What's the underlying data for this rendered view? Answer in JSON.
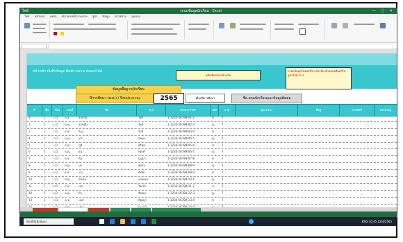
{
  "window": {
    "title": "ระบบข้อมูลนักเรียน - Excel",
    "left_text": "ไฟล์",
    "controls": "— ▢ ✕"
  },
  "menubar": [
    "ไฟล์",
    "หน้าแรก",
    "แทรก",
    "เค้าโครงหน้ากระดาษ",
    "สูตร",
    "ข้อมูล",
    "ตรวจทาน",
    "มุมมอง"
  ],
  "sheet": {
    "menu_line": "หน้าหลัก  บันทึกข้อมูล  พิมพ์รายงาน  ส่งออกไฟล์",
    "title_box": "ข้อมูลพื้นฐานนักเรียน",
    "year_label": "ปีการศึกษา (พ.ศ.) / ปีงบประมาณ",
    "year_value": "2565",
    "button_label": "เลือกปีการศึกษา",
    "grey_header": "ชื่อ-สกุลนักเรียนและข้อมูลติดต่อ",
    "note1": "คลิกเพื่อกลับหน้าหลัก",
    "note2": "กรอกข้อมูลในช่องสีขาวเท่านั้น ห้ามลบหรือแก้ไขสูตรในตาราง"
  },
  "table_headers": [
    "ที่",
    "ชั้น",
    "ห้อง",
    "เลขที่",
    "ชื่อ",
    "สกุล",
    "เลขประจำตัว",
    "เพศ",
    "อายุ",
    "ผู้ปกครอง",
    "ที่อยู่",
    "โทรศัพท์",
    "หมายเหตุ"
  ],
  "rows": [
    [
      "1",
      "1",
      "ป.1",
      "ด.ช.",
      "สมชาย",
      "ใจดี",
      "1-1234-56789-01-2",
      "ช",
      "7"
    ],
    [
      "2",
      "1",
      "ป.1",
      "ด.ญ.",
      "สมหญิง",
      "ใจดี",
      "1-1234-56789-02-3",
      "ญ",
      "7"
    ],
    [
      "3",
      "1",
      "ป.1",
      "ด.ช.",
      "ก้อง",
      "รักดี",
      "1-1234-56789-03-4",
      "ช",
      "7"
    ],
    [
      "4",
      "1",
      "ป.1",
      "ด.ญ.",
      "แก้ว",
      "มั่นคง",
      "1-1234-56789-04-5",
      "ญ",
      "7"
    ],
    [
      "5",
      "1",
      "ป.1",
      "ด.ช.",
      "ภูมิ",
      "ศรีสุข",
      "1-1234-56789-05-6",
      "ช",
      "7"
    ],
    [
      "6",
      "1",
      "ป.1",
      "ด.ญ.",
      "ฝน",
      "ทองดี",
      "1-1234-56789-06-7",
      "ญ",
      "7"
    ],
    [
      "7",
      "1",
      "ป.1",
      "ด.ช.",
      "ต้น",
      "บุญมา",
      "1-1234-56789-07-8",
      "ช",
      "7"
    ],
    [
      "8",
      "1",
      "ป.1",
      "ด.ญ.",
      "นก",
      "สุขใจ",
      "1-1234-56789-08-9",
      "ญ",
      "7"
    ],
    [
      "9",
      "1",
      "ป.1",
      "ด.ช.",
      "เก่ง",
      "ดีเลิศ",
      "1-1234-56789-09-0",
      "ช",
      "7"
    ],
    [
      "10",
      "1",
      "ป.1",
      "ด.ญ.",
      "ใบเตย",
      "แสงทอง",
      "1-1234-56789-10-1",
      "ญ",
      "7"
    ],
    [
      "11",
      "1",
      "ป.1",
      "ด.ช.",
      "เอก",
      "ใจกล้า",
      "1-1234-56789-11-2",
      "ช",
      "7"
    ],
    [
      "12",
      "1",
      "ป.1",
      "ด.ญ.",
      "มิว",
      "ชื่นชม",
      "1-1234-56789-12-3",
      "ญ",
      "7"
    ],
    [
      "13",
      "1",
      "ป.1",
      "ด.ช.",
      "บอส",
      "ปัญญา",
      "1-1234-56789-13-4",
      "ช",
      "7"
    ],
    [
      "14",
      "1",
      "ป.1",
      "ด.ญ.",
      "ปลา",
      "ทะเลใส",
      "1-1234-56789-14-5",
      "ญ",
      "7"
    ]
  ],
  "sheet_tabs": [
    "หน้าหลัก",
    "ข้อมูลนักเรียน",
    "รายงาน",
    "สรุป",
    "ตั้งค่า"
  ],
  "taskbar": {
    "search_placeholder": "พิมพ์ที่นี่เพื่อค้นหา",
    "tray": "ENG  10:45  12/4/2565"
  }
}
